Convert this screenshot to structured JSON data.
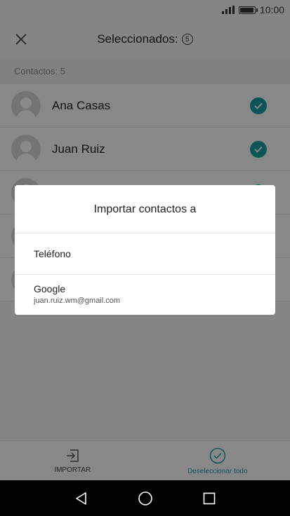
{
  "status_bar": {
    "time": "10:00"
  },
  "app_bar": {
    "title": "Seleccionados:",
    "count": "5"
  },
  "section": {
    "header": "Contactos: 5"
  },
  "contacts": [
    {
      "name": "Ana Casas",
      "checked": true
    },
    {
      "name": "Juan Ruiz",
      "checked": true
    },
    {
      "name": "",
      "checked": true
    },
    {
      "name": "",
      "checked": true
    },
    {
      "name": "",
      "checked": true
    }
  ],
  "dialog": {
    "title": "Importar contactos a",
    "options": [
      {
        "label": "Teléfono"
      },
      {
        "label": "Google",
        "sublabel": "juan.ruiz.wm@gmail.com"
      }
    ]
  },
  "bottom_bar": {
    "import_label": "IMPORTAR",
    "deselect_label": "Deseleccionar todo"
  },
  "colors": {
    "accent": "#1a9ba1",
    "overlay": "rgba(0,0,0,0.45)"
  }
}
